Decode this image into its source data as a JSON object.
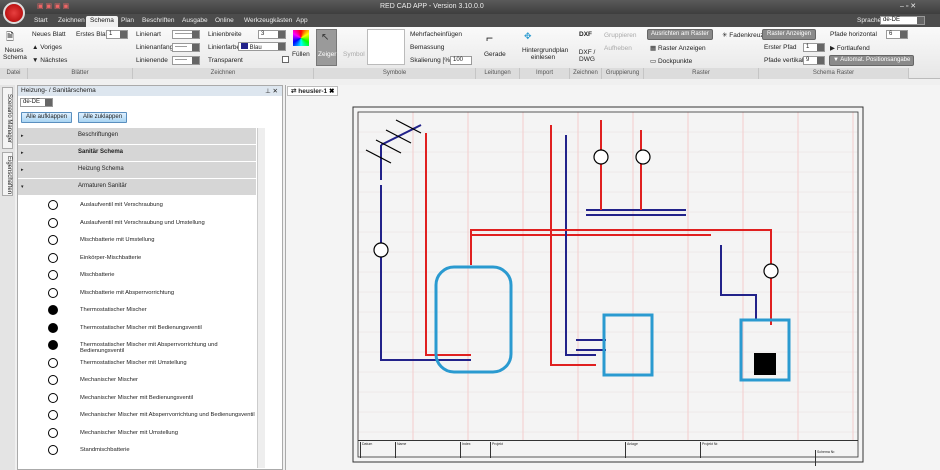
{
  "app": {
    "title": "RED CAD APP - Version 3.10.0.0",
    "language_label": "Sprache",
    "language": "de-DE"
  },
  "tabs": [
    "Start",
    "Zeichnen",
    "Schema",
    "Plan",
    "Beschriften",
    "Ausgabe",
    "Online",
    "Werkzeugkästen",
    "App"
  ],
  "ribbon": {
    "datei": {
      "label": "Datei",
      "new_schema": "Neues Schema"
    },
    "blaetter": {
      "label": "Blätter",
      "new_sheet": "Neues Blatt",
      "first_sheet_label": "Erstes Blatt",
      "first_sheet": "1",
      "prev": "Voriges",
      "next": "Nächstes"
    },
    "zeichnen": {
      "label": "Zeichnen",
      "linienart": "Linienart",
      "linienanfang": "Linienanfang",
      "linienende": "Linienende",
      "linienbreite": "Linienbreite",
      "linienbreite_val": "3",
      "linienfarbe": "Linienfarbe",
      "linienfarbe_val": "Blau",
      "transparent": "Transparent",
      "fuellen": "Füllen"
    },
    "symbole": {
      "label": "Symbole",
      "zeiger": "Zeiger",
      "symbol": "Symbol",
      "mehrfach": "Mehrfacheinfügen",
      "bemassung": "Bemassung",
      "skalierung": "Skalierung [%]",
      "skalierung_val": "100"
    },
    "leitungen": {
      "label": "Leitungen",
      "gerade": "Gerade"
    },
    "import": {
      "label": "Import",
      "hintergrund": "Hintergrundplan einlesen"
    },
    "zeichnen2": {
      "label": "Zeichnen",
      "dxf": "DXF / DWG",
      "dxf_icon": "DXF"
    },
    "gruppierung": {
      "label": "Gruppierung",
      "gruppieren": "Gruppieren",
      "aufheben": "Aufheben"
    },
    "raster": {
      "label": "Raster",
      "ausrichten": "Ausrichten am Raster",
      "fadenkreuz": "Fadenkreuz",
      "anzeigen": "Raster Anzeigen",
      "dockpunkte": "Dockpunkte"
    },
    "schema_raster": {
      "label": "Schema Raster",
      "raster_anzeigen": "Raster Anzeigen",
      "erster_pfad": "Erster Pfad",
      "erster_pfad_val": "1",
      "pfade_h": "Pfade horizontal",
      "pfade_h_val": "6",
      "fortlaufend": "Fortlaufend",
      "pfade_v": "Pfade vertikal",
      "pfade_v_val": "9",
      "auto": "Automat. Positionsangabe"
    }
  },
  "side_tabs": [
    "Scenario Manager",
    "Eigenschaften"
  ],
  "panel": {
    "title": "Heizung- / Sanitärschema",
    "lang": "de-DE",
    "expand": "Alle aufklappen",
    "collapse": "Alle zuklappen",
    "categories": [
      "Beschriftungen",
      "Sanitär Schema",
      "Heizung Schema",
      "Armaturen Sanitär"
    ],
    "text_icon": "Text",
    "items": [
      "Auslaufventil mit Verschraubung",
      "Auslaufventil mit Verschraubung und Umstellung",
      "Mischbatterie mit Umstellung",
      "Einkörper-Mischbatterie",
      "Mischbatterie",
      "Mischbatterie mit Absperrvorrichtung",
      "Thermostatischer Mischer",
      "Thermostatischer Mischer mit Bedienungsventil",
      "Thermostatischer Mischer mit Absperrvorrichtung und Bedienungsventil",
      "Thermostatischer Mischer mit Umstellung",
      "Mechanischer Mischer",
      "Mechanischer Mischer mit Bedienungsventil",
      "Mechanischer Mischer mit Absperrvorrichtung und Bedienungsventil",
      "Mechanischer Mischer mit Umstellung",
      "Standmischbatterie"
    ]
  },
  "document": {
    "tab": "heusler-1",
    "titleblock": [
      "Datum",
      "Name",
      "Index",
      "Projekt",
      "Anlage",
      "Projekt Nr.",
      "Schema Nr."
    ]
  },
  "colors": {
    "hot": "#e02020",
    "cold": "#22228a",
    "equip": "#2a9ad0"
  }
}
